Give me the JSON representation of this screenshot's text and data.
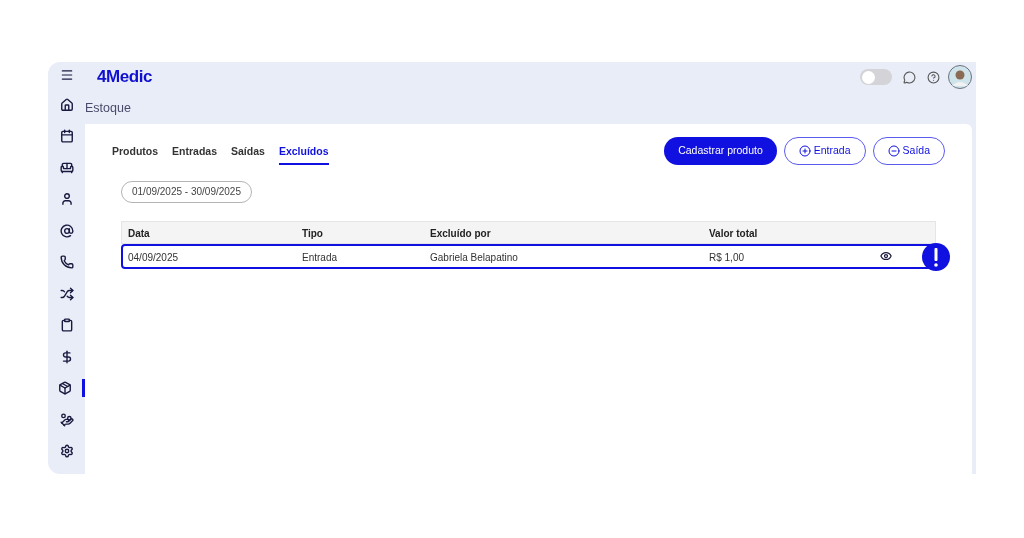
{
  "header": {
    "logo": "4Medic",
    "theme_toggle": {
      "on": false
    }
  },
  "sidebar": {
    "items": [
      {
        "selected": false
      },
      {
        "selected": false
      },
      {
        "selected": false
      },
      {
        "selected": false
      },
      {
        "selected": false
      },
      {
        "selected": false
      },
      {
        "selected": false
      },
      {
        "selected": false
      },
      {
        "selected": false
      },
      {
        "selected": true
      },
      {
        "selected": false
      },
      {
        "selected": false
      }
    ]
  },
  "page_title": "Estoque",
  "tabs": [
    {
      "label": "Produtos",
      "selected": false
    },
    {
      "label": "Entradas",
      "selected": false
    },
    {
      "label": "Saídas",
      "selected": false
    },
    {
      "label": "Excluídos",
      "selected": true
    }
  ],
  "actions": [
    {
      "kind": "primary",
      "label": "Cadastrar produto"
    },
    {
      "kind": "add",
      "label": "Entrada"
    },
    {
      "kind": "remove",
      "label": "Saída"
    }
  ],
  "date_filter": "01/09/2025 - 30/09/2025",
  "table": {
    "columns": [
      "Data",
      "Tipo",
      "Excluído por",
      "Valor total"
    ],
    "rows": [
      {
        "cells": [
          "04/09/2025",
          "Entrada",
          "Gabriela Belapatino",
          "R$ 1,00"
        ],
        "highlighted": true
      }
    ]
  }
}
